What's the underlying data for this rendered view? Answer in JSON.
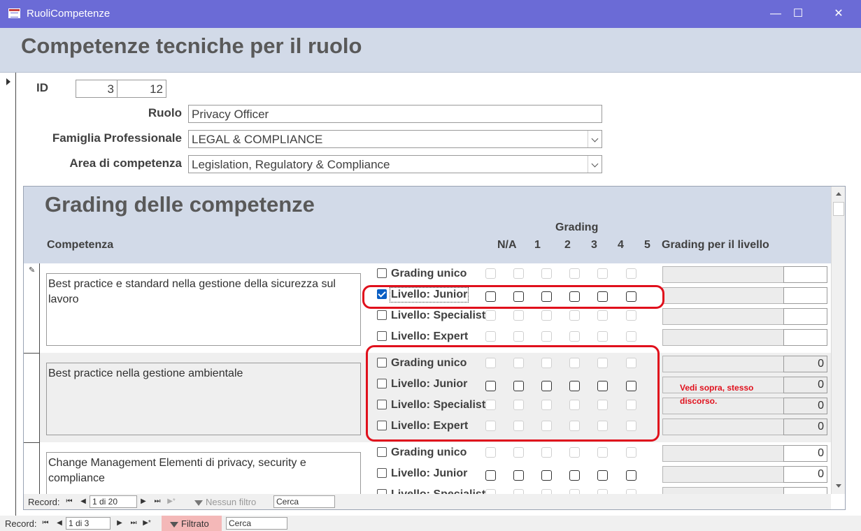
{
  "window": {
    "title": "RuoliCompetenze",
    "minimize": "—",
    "maximize": "☐",
    "close": "✕"
  },
  "form": {
    "title": "Competenze tecniche per il ruolo"
  },
  "fields": {
    "id_label": "ID",
    "id_value_1": "3",
    "id_value_2": "12",
    "ruolo_label": "Ruolo",
    "ruolo_value": "Privacy Officer",
    "famiglia_label": "Famiglia Professionale",
    "famiglia_value": "LEGAL & COMPLIANCE",
    "area_label": "Area di competenza",
    "area_value": "Legislation, Regulatory & Compliance"
  },
  "subform": {
    "title": "Grading delle competenze",
    "col_competenza": "Competenza",
    "col_grading": "Grading",
    "col_na": "N/A",
    "grades": [
      "1",
      "2",
      "3",
      "4",
      "5"
    ],
    "col_livello": "Grading per il livello",
    "records": [
      {
        "competenza": "Best practice e standard nella gestione della sicurezza sul lavoro",
        "rows": [
          {
            "label": "Grading unico",
            "checked": false,
            "value": ""
          },
          {
            "label": "Livello: Junior",
            "checked": true,
            "value": ""
          },
          {
            "label": "Livello: Specialist",
            "checked": false,
            "value": ""
          },
          {
            "label": "Livello: Expert",
            "checked": false,
            "value": ""
          }
        ]
      },
      {
        "competenza": "Best practice nella gestione ambientale",
        "rows": [
          {
            "label": "Grading unico",
            "checked": false,
            "value": "0"
          },
          {
            "label": "Livello: Junior",
            "checked": false,
            "value": "0"
          },
          {
            "label": "Livello: Specialist",
            "checked": false,
            "value": "0"
          },
          {
            "label": "Livello: Expert",
            "checked": false,
            "value": "0"
          }
        ]
      },
      {
        "competenza": "Change Management Elementi di privacy, security e compliance",
        "rows": [
          {
            "label": "Grading unico",
            "checked": false,
            "value": "0"
          },
          {
            "label": "Livello: Junior",
            "checked": false,
            "value": "0"
          },
          {
            "label": "Livello: Specialist",
            "checked": false,
            "value": ""
          }
        ]
      }
    ],
    "nav": {
      "label": "Record:",
      "current": "1 di 20",
      "filter": "Nessun filtro",
      "search": "Cerca"
    }
  },
  "annotation": {
    "note": "Vedi sopra, stesso discorso.",
    "color": "#e0101c"
  },
  "main_nav": {
    "label": "Record:",
    "current": "1 di 3",
    "filter": "Filtrato",
    "search": "Cerca"
  },
  "icons": {
    "app": "form-icon",
    "filter": "funnel-icon",
    "pencil": "pencil-icon"
  }
}
